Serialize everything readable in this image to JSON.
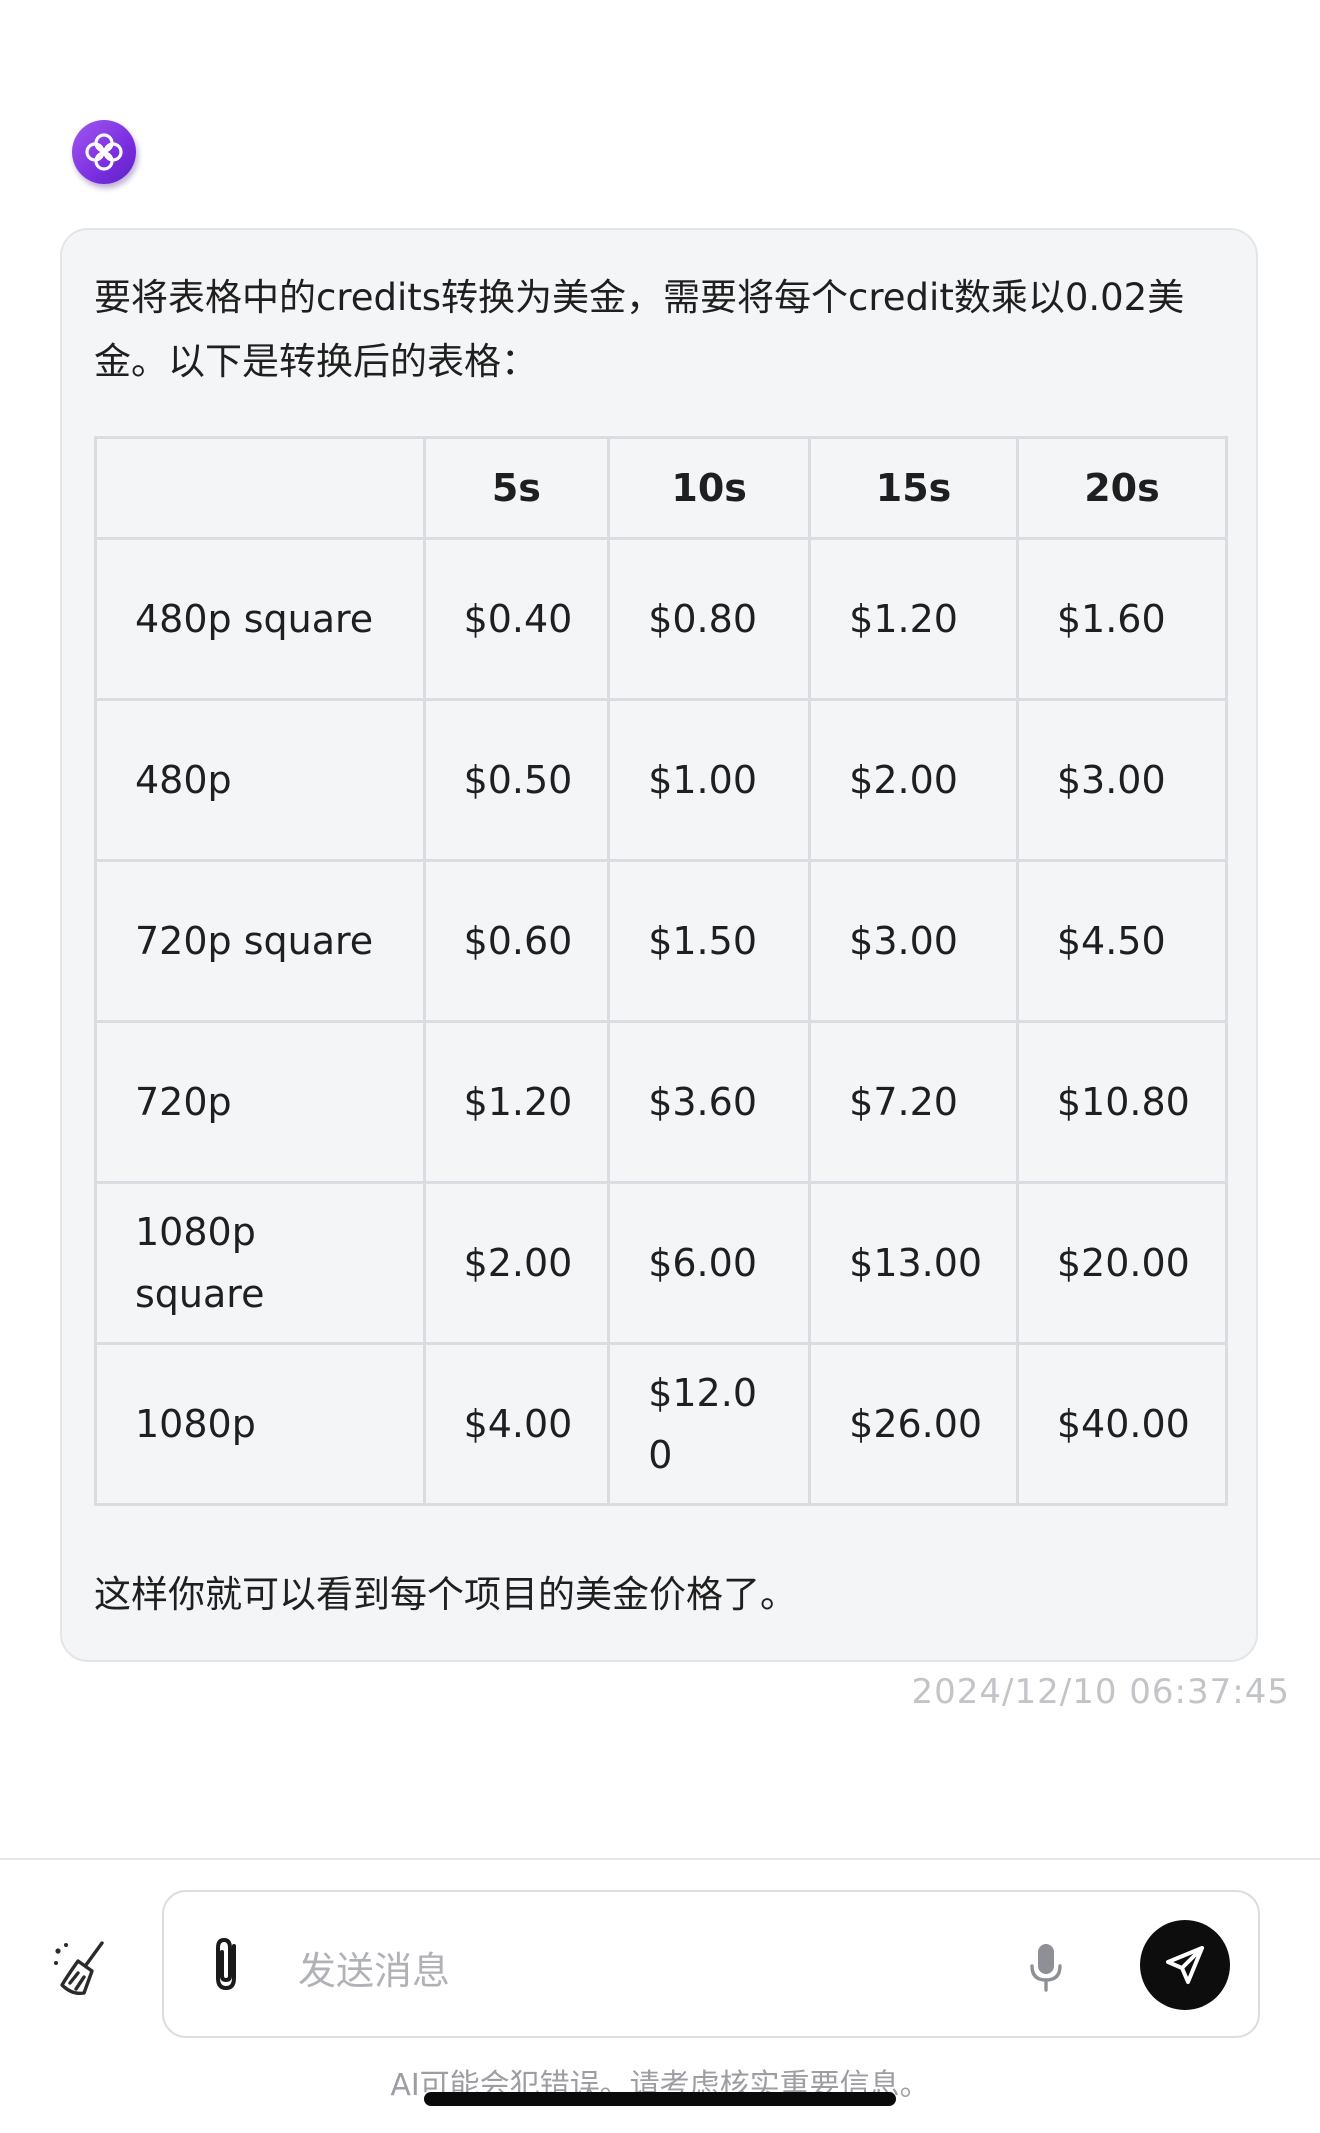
{
  "message": {
    "intro": "要将表格中的credits转换为美金，需要将每个credit数乘以0.02美金。以下是转换后的表格：",
    "table": {
      "headers": [
        "",
        "5s",
        "10s",
        "15s",
        "20s"
      ],
      "rows": [
        {
          "label": "480p square",
          "cells": [
            "$0.40",
            "$0.80",
            "$1.20",
            "$1.60"
          ]
        },
        {
          "label": "480p",
          "cells": [
            "$0.50",
            "$1.00",
            "$2.00",
            "$3.00"
          ]
        },
        {
          "label": "720p square",
          "cells": [
            "$0.60",
            "$1.50",
            "$3.00",
            "$4.50"
          ]
        },
        {
          "label": "720p",
          "cells": [
            "$1.20",
            "$3.60",
            "$7.20",
            "$10.80"
          ]
        },
        {
          "label": "1080p square",
          "cells": [
            "$2.00",
            "$6.00",
            "$13.00",
            "$20.00"
          ]
        },
        {
          "label": "1080p",
          "cells": [
            "$4.00",
            "$12.00",
            "$26.00",
            "$40.00"
          ]
        }
      ]
    },
    "closing": "这样你就可以看到每个项目的美金价格了。",
    "timestamp": "2024/12/10 06:37:45"
  },
  "input": {
    "placeholder": "发送消息"
  },
  "disclaimer": "AI可能会犯错误。请考虑核实重要信息。",
  "icons": {
    "avatar": "assistant-logo-icon",
    "clear": "broom-icon",
    "attach": "paperclip-icon",
    "mic": "microphone-icon",
    "send": "send-arrow-icon"
  },
  "colors": {
    "avatar": "#8b3fe8",
    "bubble": "#f4f5f7",
    "send": "#0d0d0d"
  }
}
